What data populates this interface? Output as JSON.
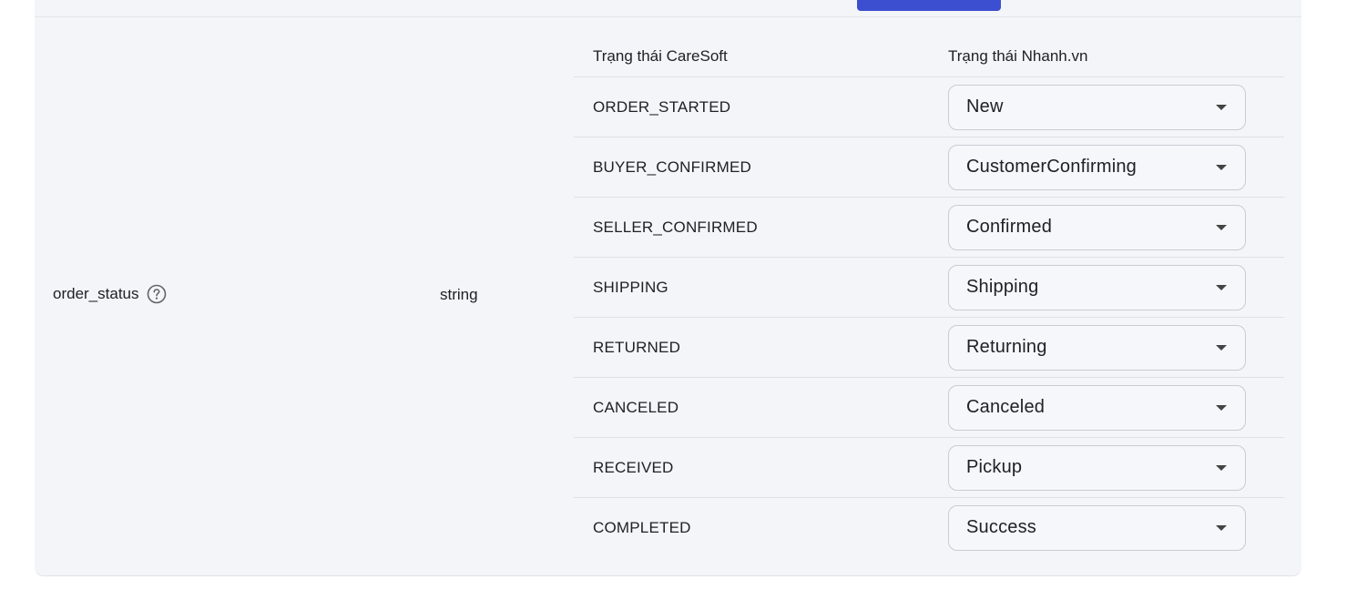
{
  "field": {
    "name": "order_status",
    "type": "string"
  },
  "mapping": {
    "header_left": "Trạng thái CareSoft",
    "header_right": "Trạng thái Nhanh.vn",
    "rows": [
      {
        "caresoft": "ORDER_STARTED",
        "nhanh": "New"
      },
      {
        "caresoft": "BUYER_CONFIRMED",
        "nhanh": "CustomerConfirming"
      },
      {
        "caresoft": "SELLER_CONFIRMED",
        "nhanh": "Confirmed"
      },
      {
        "caresoft": "SHIPPING",
        "nhanh": "Shipping"
      },
      {
        "caresoft": "RETURNED",
        "nhanh": "Returning"
      },
      {
        "caresoft": "CANCELED",
        "nhanh": "Canceled"
      },
      {
        "caresoft": "RECEIVED",
        "nhanh": "Pickup"
      },
      {
        "caresoft": "COMPLETED",
        "nhanh": "Success"
      }
    ]
  },
  "colors": {
    "accent": "#3c4fd1",
    "panel_bg": "#f4f5f9"
  }
}
